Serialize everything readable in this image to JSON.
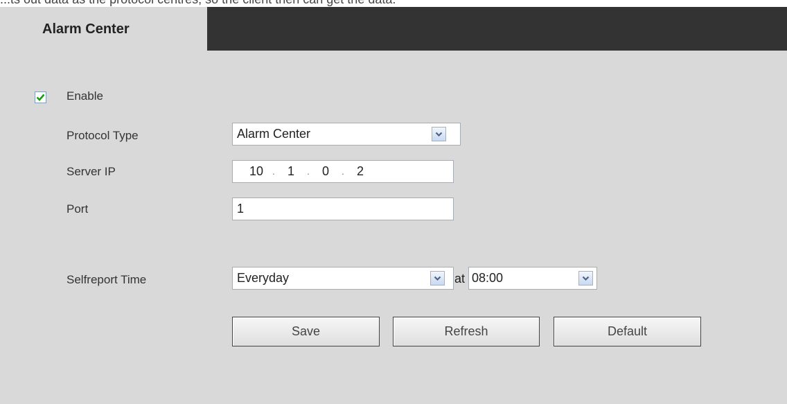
{
  "top_text": "...ts out data as the protocol centres, so the client then can get the data.",
  "tab": {
    "label": "Alarm Center"
  },
  "form": {
    "enable": {
      "label": "Enable",
      "checked": true
    },
    "protocol_type": {
      "label": "Protocol Type",
      "value": "Alarm Center"
    },
    "server_ip": {
      "label": "Server IP",
      "octets": [
        "10",
        "1",
        "0",
        "2"
      ]
    },
    "port": {
      "label": "Port",
      "value": "1"
    },
    "selfreport_time": {
      "label": "Selfreport Time",
      "day_value": "Everyday",
      "at_label": "at",
      "time_value": "08:00"
    }
  },
  "buttons": {
    "save": "Save",
    "refresh": "Refresh",
    "default": "Default"
  },
  "icons": {
    "checkbox_check": "check-icon",
    "dropdown_arrow": "chevron-down-icon"
  },
  "colors": {
    "tab_bar": "#333333",
    "panel": "#d9d9d9",
    "check": "#1a9a1a",
    "dropdown_arrow": "#4d6185"
  }
}
